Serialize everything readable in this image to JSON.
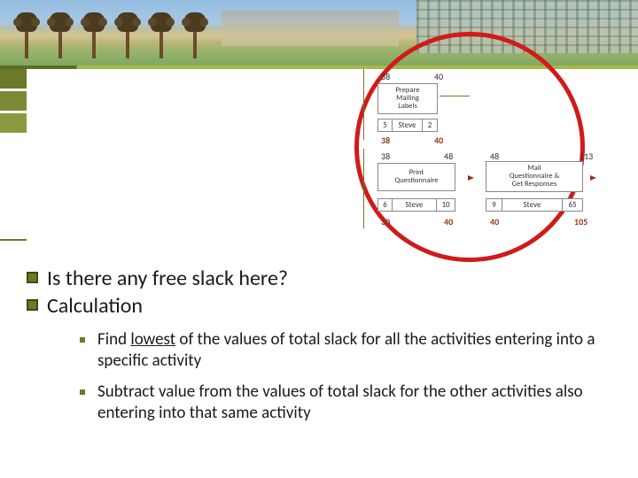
{
  "bullets": {
    "b1": "Is there any free slack here?",
    "b2": "Calculation",
    "sub1_pre": "Find ",
    "sub1_u": "lowest",
    "sub1_post": " of the values of total slack for all the activities entering into a specific activity",
    "sub2": "Subtract value from the values of total slack for the other activities also entering into that same activity"
  },
  "diagram": {
    "top_a": "38",
    "top_b": "40",
    "act1_l1": "Prepare",
    "act1_l2": "Mailing",
    "act1_l3": "Labels",
    "row1_a": "5",
    "row1_b": "Steve",
    "row1_c": "2",
    "mid_a": "38",
    "mid_b": "40",
    "mid_c": "38",
    "mid_d": "48",
    "mid_e": "48",
    "mid_f": "113",
    "act2_l1": "Print",
    "act2_l2": "Questionnaire",
    "act3_l1": "Mail",
    "act3_l2": "Questionnaire &",
    "act3_l3": "Get Responses",
    "row2_a": "6",
    "row2_b": "Steve",
    "row2_c": "10",
    "row3_a": "9",
    "row3_b": "Steve",
    "row3_c": "65",
    "btm_a": "30",
    "btm_b": "40",
    "btm_c": "40",
    "btm_d": "105"
  }
}
